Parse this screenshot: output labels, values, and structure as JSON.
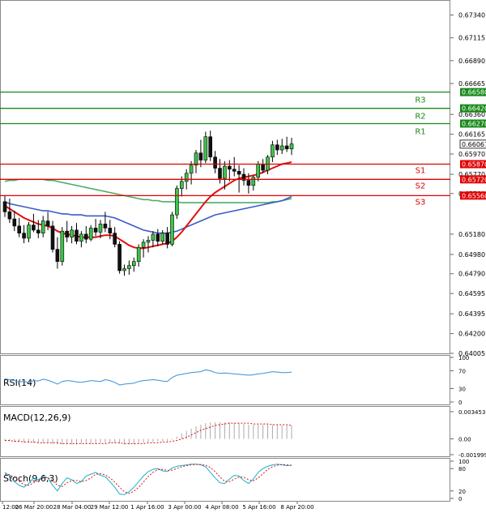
{
  "chart_data": {
    "type": "candlestick",
    "instrument_panel": {
      "y_ticks": [
        "0.67340",
        "0.67115",
        "0.66890",
        "0.66665",
        "0.66360",
        "0.66165",
        "0.65970",
        "0.65770",
        "0.65580",
        "0.65180",
        "0.64980",
        "0.64790",
        "0.64595",
        "0.64395",
        "0.64200",
        "0.64005"
      ],
      "ylim": [
        0.64005,
        0.6744
      ],
      "current_price": "0.66067",
      "levels": [
        {
          "name": "R3",
          "value": 0.6658,
          "label": "0.66580",
          "kind": "resistance",
          "color": "#1a8a1a"
        },
        {
          "name": "R2",
          "value": 0.6642,
          "label": "0.66420",
          "kind": "resistance",
          "color": "#1a8a1a"
        },
        {
          "name": "R1",
          "value": 0.6627,
          "label": "0.66270",
          "kind": "resistance",
          "color": "#1a8a1a"
        },
        {
          "name": "S1",
          "value": 0.6587,
          "label": "0.65870",
          "kind": "support",
          "color": "#e00000"
        },
        {
          "name": "S2",
          "value": 0.6572,
          "label": "0.65720",
          "kind": "support",
          "color": "#e00000"
        },
        {
          "name": "S3",
          "value": 0.6556,
          "label": "0.65560",
          "kind": "support",
          "color": "#e00000"
        }
      ],
      "candles": [
        {
          "o": 0.655,
          "h": 0.6556,
          "l": 0.6535,
          "c": 0.654
        },
        {
          "o": 0.654,
          "h": 0.6553,
          "l": 0.6529,
          "c": 0.6533
        },
        {
          "o": 0.6533,
          "h": 0.6541,
          "l": 0.6521,
          "c": 0.6526
        },
        {
          "o": 0.6526,
          "h": 0.6534,
          "l": 0.6515,
          "c": 0.6519
        },
        {
          "o": 0.6519,
          "h": 0.6527,
          "l": 0.6509,
          "c": 0.6514
        },
        {
          "o": 0.6514,
          "h": 0.653,
          "l": 0.651,
          "c": 0.6527
        },
        {
          "o": 0.6527,
          "h": 0.6538,
          "l": 0.652,
          "c": 0.6522
        },
        {
          "o": 0.6522,
          "h": 0.6532,
          "l": 0.6514,
          "c": 0.6519
        },
        {
          "o": 0.6519,
          "h": 0.6536,
          "l": 0.6515,
          "c": 0.6531
        },
        {
          "o": 0.6531,
          "h": 0.654,
          "l": 0.6522,
          "c": 0.6526
        },
        {
          "o": 0.6526,
          "h": 0.6531,
          "l": 0.65,
          "c": 0.6503
        },
        {
          "o": 0.6503,
          "h": 0.6515,
          "l": 0.6484,
          "c": 0.6491
        },
        {
          "o": 0.6491,
          "h": 0.6525,
          "l": 0.6487,
          "c": 0.6521
        },
        {
          "o": 0.6521,
          "h": 0.6531,
          "l": 0.651,
          "c": 0.6515
        },
        {
          "o": 0.6515,
          "h": 0.6526,
          "l": 0.6509,
          "c": 0.6522
        },
        {
          "o": 0.6522,
          "h": 0.6529,
          "l": 0.6508,
          "c": 0.6511
        },
        {
          "o": 0.6511,
          "h": 0.6521,
          "l": 0.6505,
          "c": 0.6518
        },
        {
          "o": 0.6518,
          "h": 0.6526,
          "l": 0.6509,
          "c": 0.6513
        },
        {
          "o": 0.6513,
          "h": 0.6527,
          "l": 0.6511,
          "c": 0.6524
        },
        {
          "o": 0.6524,
          "h": 0.6533,
          "l": 0.6516,
          "c": 0.652
        },
        {
          "o": 0.652,
          "h": 0.6532,
          "l": 0.6514,
          "c": 0.6528
        },
        {
          "o": 0.6528,
          "h": 0.654,
          "l": 0.652,
          "c": 0.6524
        },
        {
          "o": 0.6524,
          "h": 0.6532,
          "l": 0.6513,
          "c": 0.6519
        },
        {
          "o": 0.6519,
          "h": 0.6525,
          "l": 0.6505,
          "c": 0.6508
        },
        {
          "o": 0.6508,
          "h": 0.6511,
          "l": 0.6479,
          "c": 0.6482
        },
        {
          "o": 0.6482,
          "h": 0.6488,
          "l": 0.6477,
          "c": 0.6484
        },
        {
          "o": 0.6484,
          "h": 0.6492,
          "l": 0.6478,
          "c": 0.6487
        },
        {
          "o": 0.6487,
          "h": 0.6495,
          "l": 0.6481,
          "c": 0.6491
        },
        {
          "o": 0.6491,
          "h": 0.6508,
          "l": 0.6486,
          "c": 0.6505
        },
        {
          "o": 0.6505,
          "h": 0.6513,
          "l": 0.6495,
          "c": 0.651
        },
        {
          "o": 0.651,
          "h": 0.6516,
          "l": 0.65,
          "c": 0.6512
        },
        {
          "o": 0.6512,
          "h": 0.6521,
          "l": 0.6505,
          "c": 0.6518
        },
        {
          "o": 0.6518,
          "h": 0.6523,
          "l": 0.6506,
          "c": 0.6511
        },
        {
          "o": 0.6511,
          "h": 0.6522,
          "l": 0.6508,
          "c": 0.6519
        },
        {
          "o": 0.6519,
          "h": 0.6525,
          "l": 0.6504,
          "c": 0.6508
        },
        {
          "o": 0.6508,
          "h": 0.654,
          "l": 0.6506,
          "c": 0.6537
        },
        {
          "o": 0.6537,
          "h": 0.6566,
          "l": 0.6533,
          "c": 0.6563
        },
        {
          "o": 0.6563,
          "h": 0.6575,
          "l": 0.6555,
          "c": 0.657
        },
        {
          "o": 0.657,
          "h": 0.6582,
          "l": 0.6562,
          "c": 0.6578
        },
        {
          "o": 0.6578,
          "h": 0.659,
          "l": 0.6567,
          "c": 0.6586
        },
        {
          "o": 0.6586,
          "h": 0.6601,
          "l": 0.6578,
          "c": 0.6598
        },
        {
          "o": 0.6598,
          "h": 0.6611,
          "l": 0.6584,
          "c": 0.6591
        },
        {
          "o": 0.6591,
          "h": 0.6619,
          "l": 0.6588,
          "c": 0.6614
        },
        {
          "o": 0.6614,
          "h": 0.662,
          "l": 0.659,
          "c": 0.6594
        },
        {
          "o": 0.6594,
          "h": 0.66,
          "l": 0.6578,
          "c": 0.6583
        },
        {
          "o": 0.6583,
          "h": 0.6592,
          "l": 0.6568,
          "c": 0.6573
        },
        {
          "o": 0.6573,
          "h": 0.659,
          "l": 0.6562,
          "c": 0.6585
        },
        {
          "o": 0.6585,
          "h": 0.6591,
          "l": 0.657,
          "c": 0.6582
        },
        {
          "o": 0.6582,
          "h": 0.6594,
          "l": 0.6575,
          "c": 0.658
        },
        {
          "o": 0.658,
          "h": 0.6586,
          "l": 0.6559,
          "c": 0.6577
        },
        {
          "o": 0.6577,
          "h": 0.6583,
          "l": 0.6566,
          "c": 0.6571
        },
        {
          "o": 0.6571,
          "h": 0.6578,
          "l": 0.6558,
          "c": 0.6566
        },
        {
          "o": 0.6566,
          "h": 0.6576,
          "l": 0.6561,
          "c": 0.6574
        },
        {
          "o": 0.6574,
          "h": 0.659,
          "l": 0.657,
          "c": 0.6587
        },
        {
          "o": 0.6587,
          "h": 0.6592,
          "l": 0.6578,
          "c": 0.6581
        },
        {
          "o": 0.6581,
          "h": 0.6596,
          "l": 0.6577,
          "c": 0.6594
        },
        {
          "o": 0.6594,
          "h": 0.661,
          "l": 0.6589,
          "c": 0.6606
        },
        {
          "o": 0.6606,
          "h": 0.6611,
          "l": 0.6596,
          "c": 0.6601
        },
        {
          "o": 0.6601,
          "h": 0.6612,
          "l": 0.6597,
          "c": 0.6605
        },
        {
          "o": 0.6605,
          "h": 0.6614,
          "l": 0.6599,
          "c": 0.6602
        },
        {
          "o": 0.6602,
          "h": 0.6613,
          "l": 0.6596,
          "c": 0.6607
        }
      ],
      "ma_red": [
        0.6546,
        0.6543,
        0.654,
        0.6537,
        0.6534,
        0.6532,
        0.653,
        0.6528,
        0.6527,
        0.6526,
        0.6524,
        0.6521,
        0.6519,
        0.6518,
        0.6517,
        0.6516,
        0.6515,
        0.6515,
        0.6515,
        0.6515,
        0.6516,
        0.6517,
        0.6517,
        0.6516,
        0.6513,
        0.651,
        0.6507,
        0.6505,
        0.6504,
        0.6504,
        0.6505,
        0.6506,
        0.6507,
        0.6508,
        0.6509,
        0.6511,
        0.6515,
        0.652,
        0.6526,
        0.6532,
        0.6538,
        0.6544,
        0.655,
        0.6555,
        0.6559,
        0.6562,
        0.6565,
        0.6568,
        0.6571,
        0.6573,
        0.6574,
        0.6575,
        0.6576,
        0.6577,
        0.6579,
        0.6581,
        0.6583,
        0.6585,
        0.6587,
        0.6588,
        0.6589
      ],
      "ma_blue": [
        0.655,
        0.6548,
        0.6547,
        0.6546,
        0.6545,
        0.6544,
        0.6543,
        0.6542,
        0.6541,
        0.6541,
        0.654,
        0.6539,
        0.6538,
        0.6538,
        0.6537,
        0.6537,
        0.6537,
        0.6536,
        0.6536,
        0.6536,
        0.6536,
        0.6536,
        0.6535,
        0.6534,
        0.6532,
        0.653,
        0.6528,
        0.6526,
        0.6524,
        0.6522,
        0.6521,
        0.652,
        0.6519,
        0.6519,
        0.6519,
        0.652,
        0.6521,
        0.6523,
        0.6525,
        0.6527,
        0.6529,
        0.6531,
        0.6533,
        0.6535,
        0.6537,
        0.6538,
        0.6539,
        0.654,
        0.6541,
        0.6542,
        0.6543,
        0.6544,
        0.6545,
        0.6546,
        0.6547,
        0.6548,
        0.6549,
        0.655,
        0.6551,
        0.6553,
        0.6555
      ],
      "ma_green": [
        0.657,
        0.6571,
        0.6571,
        0.6572,
        0.6572,
        0.6572,
        0.6572,
        0.6572,
        0.6572,
        0.6571,
        0.6571,
        0.657,
        0.6569,
        0.6568,
        0.6567,
        0.6566,
        0.6565,
        0.6564,
        0.6563,
        0.6562,
        0.6561,
        0.656,
        0.6559,
        0.6558,
        0.6557,
        0.6556,
        0.6555,
        0.6554,
        0.6553,
        0.6552,
        0.6552,
        0.6551,
        0.6551,
        0.655,
        0.655,
        0.655,
        0.655,
        0.6549,
        0.6549,
        0.6549,
        0.6549,
        0.6549,
        0.6549,
        0.6549,
        0.6549,
        0.6549,
        0.6549,
        0.6549,
        0.6549,
        0.6549,
        0.6549,
        0.6549,
        0.6549,
        0.6549,
        0.6549,
        0.6549,
        0.655,
        0.655,
        0.6551,
        0.6552,
        0.6553
      ]
    },
    "rsi_panel": {
      "label": "RSI(14)",
      "y_ticks": [
        "100",
        "70",
        "30",
        "0"
      ],
      "ylim": [
        0,
        100
      ],
      "values": [
        52,
        50,
        48,
        45,
        46,
        44,
        48,
        47,
        51,
        49,
        45,
        40,
        46,
        48,
        47,
        45,
        44,
        46,
        48,
        47,
        46,
        50,
        48,
        44,
        38,
        40,
        41,
        42,
        46,
        48,
        49,
        50,
        49,
        47,
        46,
        55,
        60,
        62,
        64,
        66,
        67,
        68,
        72,
        70,
        66,
        64,
        65,
        64,
        63,
        62,
        61,
        60,
        61,
        63,
        64,
        66,
        68,
        67,
        66,
        66,
        67
      ]
    },
    "macd_panel": {
      "label": "MACD(12,26,9)",
      "y_ticks": [
        "0.003453",
        "0.00",
        "-0.001999"
      ],
      "ylim": [
        -0.002,
        0.00345
      ],
      "histogram": [
        -0.0002,
        -0.0003,
        -0.0004,
        -0.0004,
        -0.0005,
        -0.0005,
        -0.0005,
        -0.0005,
        -0.0005,
        -0.0005,
        -0.0006,
        -0.0007,
        -0.0007,
        -0.0007,
        -0.0007,
        -0.0007,
        -0.0006,
        -0.0006,
        -0.0006,
        -0.0006,
        -0.0005,
        -0.0005,
        -0.0005,
        -0.0005,
        -0.0006,
        -0.0007,
        -0.0007,
        -0.0007,
        -0.0006,
        -0.0005,
        -0.0004,
        -0.0004,
        -0.0003,
        -0.0003,
        -0.0003,
        -0.0001,
        0.0003,
        0.0007,
        0.001,
        0.0013,
        0.0016,
        0.0018,
        0.002,
        0.0021,
        0.0021,
        0.0021,
        0.0021,
        0.0021,
        0.002,
        0.002,
        0.0019,
        0.0018,
        0.0018,
        0.0018,
        0.0018,
        0.0018,
        0.0018,
        0.0018,
        0.0017,
        0.0017,
        0.0017
      ],
      "signal": [
        -0.0002,
        -0.0002,
        -0.0003,
        -0.0003,
        -0.0004,
        -0.0004,
        -0.0004,
        -0.0005,
        -0.0005,
        -0.0005,
        -0.0005,
        -0.0005,
        -0.0006,
        -0.0006,
        -0.0006,
        -0.0006,
        -0.0006,
        -0.0006,
        -0.0006,
        -0.0006,
        -0.0006,
        -0.0006,
        -0.0005,
        -0.0005,
        -0.0005,
        -0.0006,
        -0.0006,
        -0.0006,
        -0.0006,
        -0.0006,
        -0.0005,
        -0.0005,
        -0.0005,
        -0.0004,
        -0.0004,
        -0.0003,
        -0.0002,
        0.0,
        0.0002,
        0.0005,
        0.0008,
        0.0011,
        0.0013,
        0.0015,
        0.0017,
        0.0018,
        0.0019,
        0.002,
        0.002,
        0.002,
        0.002,
        0.002,
        0.0019,
        0.0019,
        0.0019,
        0.0019,
        0.0018,
        0.0018,
        0.0018,
        0.0018,
        0.0017
      ]
    },
    "stoch_panel": {
      "label": "Stoch(9,6,3)",
      "y_ticks": [
        "100",
        "80",
        "20",
        "0"
      ],
      "ylim": [
        0,
        100
      ],
      "main": [
        70,
        60,
        45,
        35,
        30,
        40,
        55,
        50,
        60,
        55,
        35,
        20,
        40,
        55,
        50,
        40,
        45,
        60,
        65,
        70,
        62,
        58,
        45,
        30,
        12,
        10,
        18,
        30,
        45,
        60,
        72,
        78,
        80,
        74,
        72,
        82,
        86,
        88,
        90,
        92,
        92,
        90,
        85,
        70,
        55,
        42,
        40,
        52,
        62,
        60,
        48,
        40,
        52,
        70,
        80,
        86,
        90,
        92,
        90,
        88,
        89
      ],
      "signal": [
        65,
        64,
        56,
        46,
        37,
        35,
        42,
        48,
        55,
        56,
        48,
        35,
        32,
        42,
        48,
        48,
        45,
        48,
        55,
        65,
        66,
        63,
        55,
        44,
        30,
        18,
        13,
        19,
        30,
        44,
        59,
        70,
        77,
        78,
        75,
        76,
        80,
        85,
        88,
        90,
        91,
        91,
        89,
        83,
        72,
        57,
        46,
        45,
        52,
        57,
        57,
        50,
        47,
        55,
        66,
        78,
        85,
        89,
        91,
        90,
        89
      ]
    },
    "x_ticks": [
      "12:00",
      "26 Mar 20:00",
      "28 Mar 04:00",
      "29 Mar 12:00",
      "1 Apr 16:00",
      "3 Apr 00:00",
      "4 Apr 08:00",
      "5 Apr 16:00",
      "8 Apr 20:00"
    ]
  }
}
